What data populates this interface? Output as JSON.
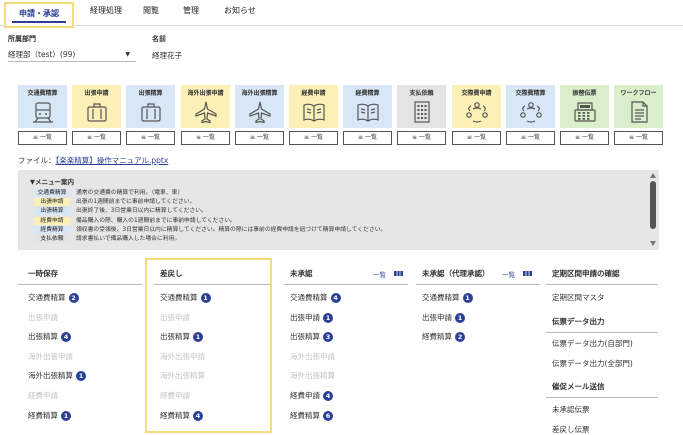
{
  "nav": {
    "active": "申請・承認",
    "tabs": [
      "経理処理",
      "閲覧",
      "管理",
      "お知らせ"
    ]
  },
  "form": {
    "dept_label": "所属部門",
    "dept_value": "経理部（test）(99)",
    "name_label": "名前",
    "name_value": "経理花子"
  },
  "tiles": [
    {
      "label": "交通費精算",
      "color": "#d8e7f6",
      "icon": "train-icon"
    },
    {
      "label": "出張申請",
      "color": "#fbf1b7",
      "icon": "suitcase-icon"
    },
    {
      "label": "出張精算",
      "color": "#d8e7f6",
      "icon": "suitcase-icon"
    },
    {
      "label": "海外出張申請",
      "color": "#fbf1b7",
      "icon": "airplane-icon"
    },
    {
      "label": "海外出張精算",
      "color": "#d8e7f6",
      "icon": "airplane-icon"
    },
    {
      "label": "経費申請",
      "color": "#fbf1b7",
      "icon": "book-icon"
    },
    {
      "label": "経費精算",
      "color": "#d8e7f6",
      "icon": "book-icon"
    },
    {
      "label": "支払依頼",
      "color": "#e4e4e4",
      "icon": "building-icon"
    },
    {
      "label": "交際費申請",
      "color": "#fbf1b7",
      "icon": "people-icon"
    },
    {
      "label": "交際費精算",
      "color": "#d8e7f6",
      "icon": "people-icon"
    },
    {
      "label": "振替伝票",
      "color": "#d9efcc",
      "icon": "register-icon"
    },
    {
      "label": "ワークフロー",
      "color": "#d9efcc",
      "icon": "document-icon"
    }
  ],
  "list_button": "≡ 一覧",
  "file": {
    "label": "ファイル：",
    "link": "【楽楽精算】操作マニュアル.pptx"
  },
  "guide": {
    "title": "▼メニュー案内",
    "rows": [
      {
        "badge": "交通費精算",
        "color": "#d8e7f6",
        "text": "通常の交通費の精算で利用。（電車、車）"
      },
      {
        "badge": "出張申請",
        "color": "#fbf1b7",
        "text": "出張の1週間前までに事前申請してください。"
      },
      {
        "badge": "出張精算",
        "color": "#d8e7f6",
        "text": "出張終了後、3日営業日以内に精算してください。"
      },
      {
        "badge": "経費申請",
        "color": "#fbf1b7",
        "text": "備品購入の際、購入の1週間前までに事前申請してください。"
      },
      {
        "badge": "経費精算",
        "color": "#d8e7f6",
        "text": "領収書の受領後、3日営業日以内に精算してください。精算の際には事前の経費申請を紐づけて精算申請してください。"
      },
      {
        "badge": "支払依頼",
        "color": "#e4e4e4",
        "text": "請求書払いで備品購入した場合に利用。"
      }
    ]
  },
  "columns": [
    {
      "title": "一時保存",
      "items": [
        {
          "label": "交通費精算",
          "count": "2"
        },
        {
          "label": "出張申請",
          "count": ""
        },
        {
          "label": "出張精算",
          "count": "4"
        },
        {
          "label": "海外出張申請",
          "count": ""
        },
        {
          "label": "海外出張精算",
          "count": "1"
        },
        {
          "label": "経費申請",
          "count": ""
        },
        {
          "label": "経費精算",
          "count": "1"
        }
      ]
    },
    {
      "title": "差戻し",
      "items": [
        {
          "label": "交通費精算",
          "count": "1"
        },
        {
          "label": "出張申請",
          "count": ""
        },
        {
          "label": "出張精算",
          "count": "1"
        },
        {
          "label": "海外出張申請",
          "count": ""
        },
        {
          "label": "海外出張精算",
          "count": ""
        },
        {
          "label": "経費申請",
          "count": ""
        },
        {
          "label": "経費精算",
          "count": "4"
        }
      ]
    },
    {
      "title": "未承認",
      "items": [
        {
          "label": "交通費精算",
          "count": "4"
        },
        {
          "label": "出張申請",
          "count": "1"
        },
        {
          "label": "出張精算",
          "count": "3"
        },
        {
          "label": "海外出張申請",
          "count": ""
        },
        {
          "label": "海外出張精算",
          "count": ""
        },
        {
          "label": "経費申請",
          "count": "4"
        },
        {
          "label": "経費精算",
          "count": "6"
        }
      ]
    },
    {
      "title": "未承認（代理承認）",
      "items": [
        {
          "label": "交通費精算",
          "count": "1"
        },
        {
          "label": "出張申請",
          "count": "1"
        },
        {
          "label": "経費精算",
          "count": "2"
        }
      ]
    }
  ],
  "ichiran": "一覧",
  "right": {
    "sec1": "定期区間申請の確認",
    "sec1_items": [
      "定期区間マスタ"
    ],
    "sec2": "伝票データ出力",
    "sec2_items": [
      "伝票データ出力(自部門)",
      "伝票データ出力(全部門)"
    ],
    "sec3": "催促メール送信",
    "sec3_items": [
      "未承認伝票",
      "差戻し伝票"
    ]
  }
}
